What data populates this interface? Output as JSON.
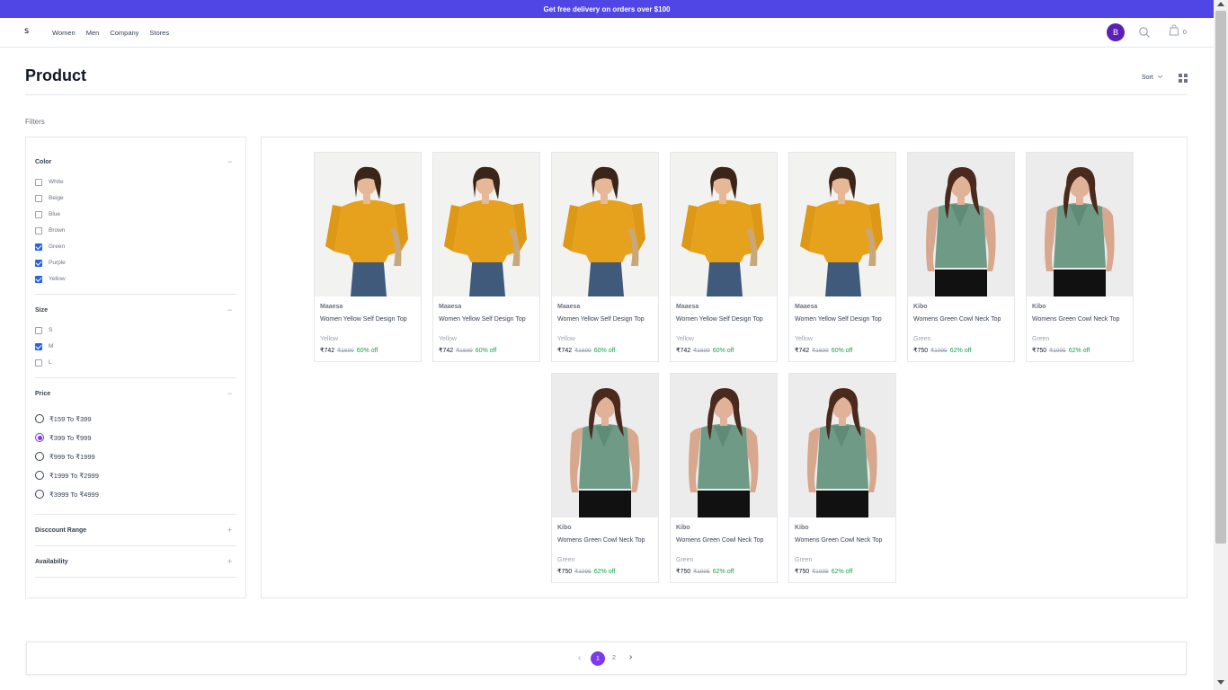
{
  "banner": {
    "text": "Get free delivery on orders over $100"
  },
  "nav": {
    "logo": "ꜱ",
    "links": [
      "Women",
      "Men",
      "Company",
      "Stores"
    ],
    "avatar_initial": "B",
    "cart_count": "0"
  },
  "page": {
    "title": "Product",
    "sort_label": "Sort",
    "filters_label": "Filters"
  },
  "filters": {
    "color": {
      "title": "Color",
      "toggle": "−",
      "options": [
        {
          "label": "White",
          "checked": false
        },
        {
          "label": "Beige",
          "checked": false
        },
        {
          "label": "Blue",
          "checked": false
        },
        {
          "label": "Brown",
          "checked": false
        },
        {
          "label": "Green",
          "checked": true
        },
        {
          "label": "Purple",
          "checked": true
        },
        {
          "label": "Yellow",
          "checked": true
        }
      ]
    },
    "size": {
      "title": "Size",
      "toggle": "−",
      "options": [
        {
          "label": "S",
          "checked": false
        },
        {
          "label": "M",
          "checked": true
        },
        {
          "label": "L",
          "checked": false
        }
      ]
    },
    "price": {
      "title": "Price",
      "toggle": "−",
      "options": [
        {
          "label": "₹159 To ₹399",
          "selected": false
        },
        {
          "label": "₹399 To ₹999",
          "selected": true
        },
        {
          "label": "₹999 To ₹1999",
          "selected": false
        },
        {
          "label": "₹1999 To ₹2999",
          "selected": false
        },
        {
          "label": "₹3999 To ₹4999",
          "selected": false
        }
      ]
    },
    "discount": {
      "title": "Disccount Range",
      "toggle": "+"
    },
    "availability": {
      "title": "Availability",
      "toggle": "+"
    }
  },
  "products": [
    {
      "brand": "Maaesa",
      "name": "Women Yellow Self Design Top",
      "color": "Yellow",
      "price": "₹742",
      "mrp": "₹1699",
      "off": "60% off",
      "image": "yellow-top"
    },
    {
      "brand": "Maaesa",
      "name": "Women Yellow Self Design Top",
      "color": "Yellow",
      "price": "₹742",
      "mrp": "₹1699",
      "off": "60% off",
      "image": "yellow-top"
    },
    {
      "brand": "Maaesa",
      "name": "Women Yellow Self Design Top",
      "color": "Yellow",
      "price": "₹742",
      "mrp": "₹1699",
      "off": "60% off",
      "image": "yellow-top"
    },
    {
      "brand": "Maaesa",
      "name": "Women Yellow Self Design Top",
      "color": "Yellow",
      "price": "₹742",
      "mrp": "₹1699",
      "off": "60% off",
      "image": "yellow-top"
    },
    {
      "brand": "Maaesa",
      "name": "Women Yellow Self Design Top",
      "color": "Yellow",
      "price": "₹742",
      "mrp": "₹1699",
      "off": "60% off",
      "image": "yellow-top"
    },
    {
      "brand": "Kibo",
      "name": "Womens Green Cowl Neck Top",
      "color": "Green",
      "price": "₹750",
      "mrp": "₹1995",
      "off": "62% off",
      "image": "green-top"
    },
    {
      "brand": "Kibo",
      "name": "Womens Green Cowl Neck Top",
      "color": "Green",
      "price": "₹750",
      "mrp": "₹1995",
      "off": "62% off",
      "image": "green-top"
    },
    {
      "brand": "Kibo",
      "name": "Womens Green Cowl Neck Top",
      "color": "Green",
      "price": "₹750",
      "mrp": "₹1995",
      "off": "62% off",
      "image": "green-top"
    },
    {
      "brand": "Kibo",
      "name": "Womens Green Cowl Neck Top",
      "color": "Green",
      "price": "₹750",
      "mrp": "₹1995",
      "off": "62% off",
      "image": "green-top"
    },
    {
      "brand": "Kibo",
      "name": "Womens Green Cowl Neck Top",
      "color": "Green",
      "price": "₹750",
      "mrp": "₹1995",
      "off": "62% off",
      "image": "green-top"
    }
  ],
  "pagination": {
    "prev": "‹",
    "current": "1",
    "pages": [
      "2"
    ],
    "next": "›"
  },
  "colors": {
    "accent": "#4f46e5",
    "selected": "#7c3aed",
    "discount": "#16a34a",
    "checkbox": "#2563eb"
  }
}
